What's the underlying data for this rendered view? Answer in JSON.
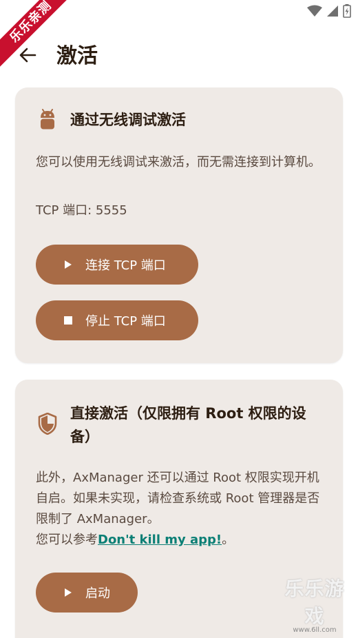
{
  "status_bar": {
    "icons": [
      "wifi-icon",
      "cell-signal-icon",
      "battery-icon"
    ]
  },
  "watermark": {
    "ribbon_text": "乐乐亲测",
    "corner_main": "乐乐游戏",
    "corner_url": "www.6ll.com"
  },
  "app_bar": {
    "title": "激活",
    "back_icon": "arrow-back-icon"
  },
  "wireless_card": {
    "icon": "android-icon",
    "title": "通过无线调试激活",
    "description": "您可以使用无线调试来激活，而无需连接到计算机。",
    "tcp_port_text": "TCP 端口: 5555",
    "connect_button_label": "连接 TCP 端口",
    "stop_button_label": "停止 TCP 端口"
  },
  "root_card": {
    "icon": "shield-icon",
    "title": "直接激活（仅限拥有 Root 权限的设备）",
    "description": "此外，AxManager 还可以通过 Root 权限实现开机自启。如果未实现，请检查系统或 Root 管理器是否限制了 AxManager。",
    "reference_prefix": "您可以参考",
    "reference_link": "Don't kill my app!",
    "reference_suffix": "。",
    "start_button_label": "启动"
  },
  "colors": {
    "accent": "#A86B46",
    "card_background": "#EFEAE6",
    "link": "#0B7F75",
    "title_text": "#2D1E12",
    "body_text": "#5A4A40",
    "ribbon": "#C8102E"
  }
}
